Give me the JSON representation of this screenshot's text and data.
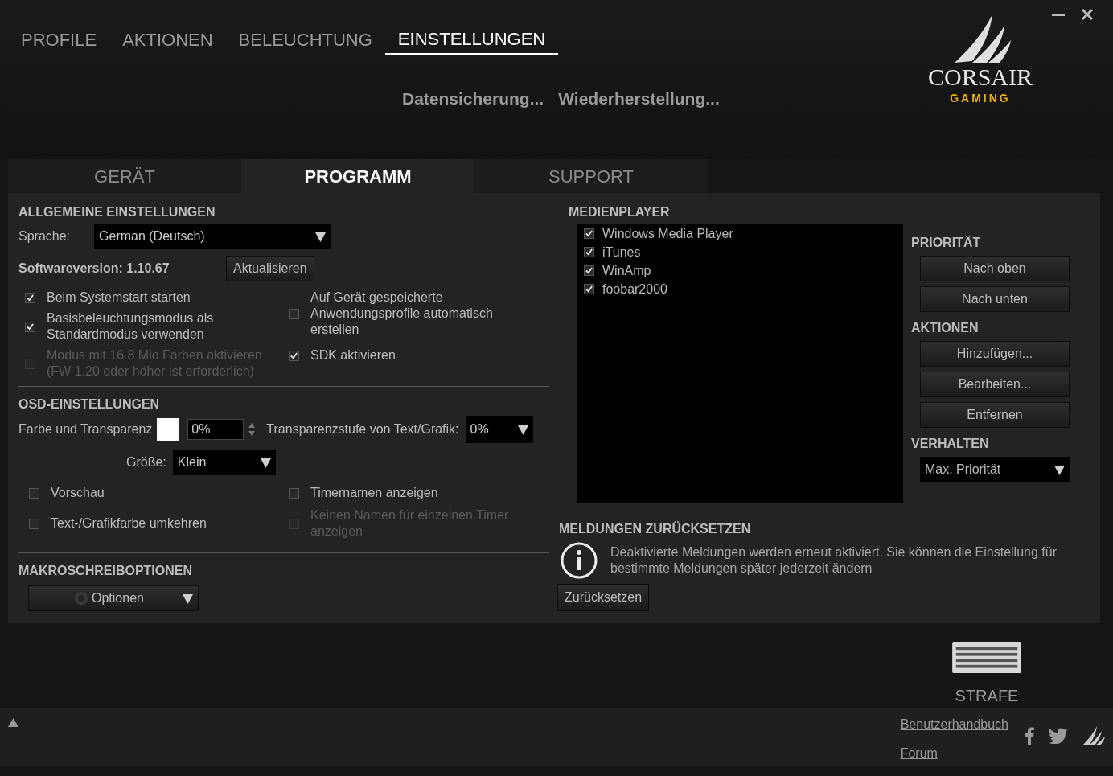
{
  "nav_tabs": [
    {
      "label": "PROFILE",
      "selected": false
    },
    {
      "label": "AKTIONEN",
      "selected": false
    },
    {
      "label": "BELEUCHTUNG",
      "selected": false
    },
    {
      "label": "EINSTELLUNGEN",
      "selected": true
    }
  ],
  "header_links": [
    "Datensicherung...",
    "Wiederherstellung..."
  ],
  "logo": {
    "name": "CORSAIR",
    "tagline": "GAMING"
  },
  "settings_tabs": [
    {
      "label": "GERÄT",
      "selected": false
    },
    {
      "label": "PROGRAMM",
      "selected": true
    },
    {
      "label": "SUPPORT",
      "selected": false
    }
  ],
  "general": {
    "title": "ALLGEMEINE EINSTELLUNGEN",
    "language_label": "Sprache:",
    "language_value": "German (Deutsch)",
    "version": "Softwareversion: 1.10.67",
    "update_button": "Aktualisieren",
    "left_options": [
      {
        "label": "Beim Systemstart starten",
        "checked": true,
        "disabled": false
      },
      {
        "label": "Basisbeleuchtungsmodus als Standardmodus verwenden",
        "checked": true,
        "disabled": false
      },
      {
        "label": "Modus mit 16.8 Mio Farben aktivieren (FW 1.20 oder höher ist erforderlich)",
        "checked": false,
        "disabled": true
      }
    ],
    "right_options": [
      {
        "label": "Auf Gerät gespeicherte Anwendungsprofile automatisch erstellen",
        "checked": false,
        "disabled": false
      },
      {
        "label": "SDK aktivieren",
        "checked": true,
        "disabled": false
      }
    ]
  },
  "osd": {
    "title": "OSD-EINSTELLUNGEN",
    "color_label": "Farbe und Transparenz",
    "color": "#ffffff",
    "transparency_value": "0%",
    "text_transparency_label": "Transparenzstufe von Text/Grafik:",
    "text_transparency_value": "0%",
    "size_label": "Größe:",
    "size_value": "Klein",
    "left_options": [
      {
        "label": "Vorschau",
        "checked": false,
        "disabled": false
      },
      {
        "label": "Text-/Grafikfarbe umkehren",
        "checked": false,
        "disabled": false
      }
    ],
    "right_options": [
      {
        "label": "Timernamen anzeigen",
        "checked": false,
        "disabled": false
      },
      {
        "label": "Keinen Namen für einzelnen Timer anzeigen",
        "checked": false,
        "disabled": true
      }
    ]
  },
  "macro": {
    "title": "MAKROSCHREIBOPTIONEN",
    "button": "Optionen"
  },
  "media": {
    "title": "MEDIENPLAYER",
    "players": [
      {
        "name": "Windows Media Player",
        "checked": true
      },
      {
        "name": "iTunes",
        "checked": true
      },
      {
        "name": "WinAmp",
        "checked": true
      },
      {
        "name": "foobar2000",
        "checked": true
      }
    ],
    "priority_title": "PRIORITÄT",
    "priority_buttons": [
      "Nach oben",
      "Nach unten"
    ],
    "actions_title": "AKTIONEN",
    "action_buttons": [
      "Hinzufügen...",
      "Bearbeiten...",
      "Entfernen"
    ],
    "behavior_title": "VERHALTEN",
    "behavior_value": "Max. Priorität"
  },
  "reset": {
    "title": "MELDUNGEN ZURÜCKSETZEN",
    "message": "Deaktivierte Meldungen werden erneut aktiviert. Sie können die Einstellung für bestimmte Meldungen später jederzeit ändern",
    "button": "Zurücksetzen"
  },
  "device": {
    "name": "STRAFE"
  },
  "footer": {
    "links": [
      "Benutzerhandbuch",
      "Forum"
    ]
  }
}
